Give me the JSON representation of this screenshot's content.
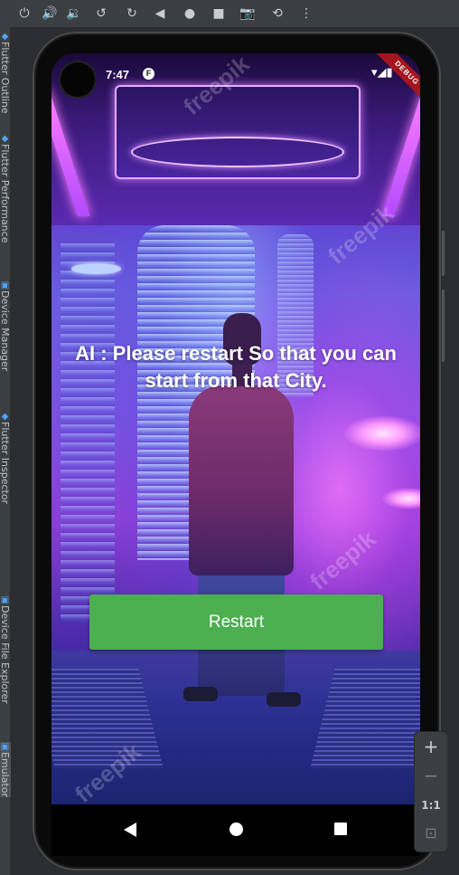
{
  "toolbar": {
    "icons": [
      "power-icon",
      "volume-up-icon",
      "volume-down-icon",
      "rotate-left-icon",
      "rotate-right-icon",
      "back-icon",
      "home-icon",
      "overview-icon",
      "screenshot-icon",
      "snapshot-icon",
      "more-icon"
    ],
    "glyphs": [
      "⏻",
      "🔊",
      "🔉",
      "↺",
      "↻",
      "◀",
      "●",
      "■",
      "📷",
      "⟲",
      "⋮"
    ]
  },
  "side_tabs": [
    {
      "label": "Flutter Outline"
    },
    {
      "label": "Flutter Performance"
    },
    {
      "label": "Device Manager"
    },
    {
      "label": "Flutter Inspector"
    },
    {
      "label": "Device File Explorer"
    },
    {
      "label": "Emulator"
    }
  ],
  "status_bar": {
    "time": "7:47",
    "app_icon": "flutter-notification-icon",
    "app_glyph": "F",
    "right_glyphs": "▾◢▮"
  },
  "debug_banner": "DEBUG",
  "screen": {
    "message": "AI : Please restart So that you can start from that City.",
    "restart_label": "Restart",
    "button_color": "#4caf50",
    "watermarks": [
      "freepik",
      "freepik",
      "freepik",
      "freepik"
    ]
  },
  "navbar": {
    "back": "back-icon",
    "home": "home-icon",
    "recents": "recents-icon"
  },
  "zoom_panel": {
    "zoom_in": "+",
    "zoom_out": "−",
    "actual_size": "1:1",
    "fit": "⊡"
  }
}
